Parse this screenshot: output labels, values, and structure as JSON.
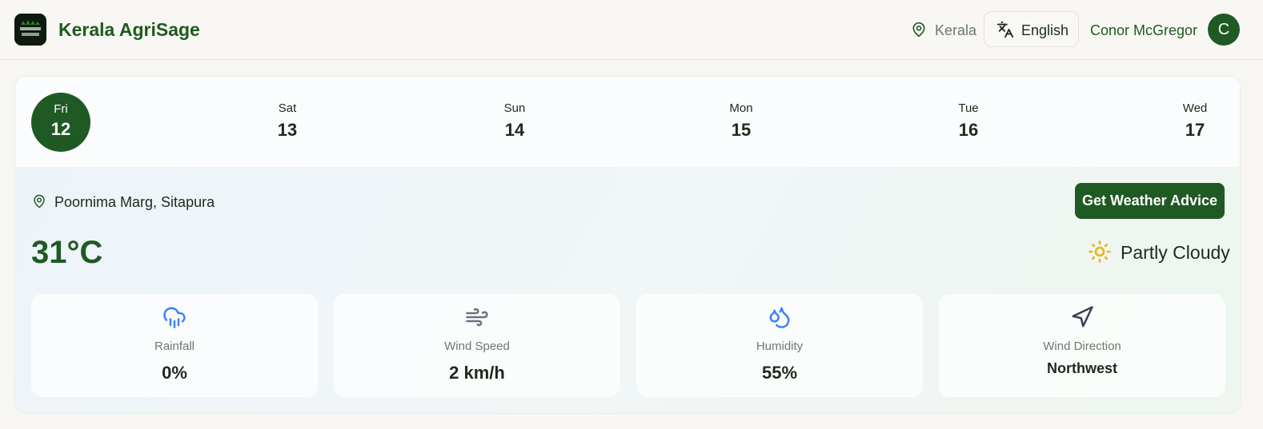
{
  "header": {
    "logo_text": "KERALA AgriSage",
    "brand": "Kerala AgriSage",
    "location": "Kerala",
    "language": "English",
    "user_name": "Conor McGregor",
    "avatar_initial": "C"
  },
  "days": [
    {
      "name": "Fri",
      "date": "12",
      "active": true
    },
    {
      "name": "Sat",
      "date": "13"
    },
    {
      "name": "Sun",
      "date": "14"
    },
    {
      "name": "Mon",
      "date": "15"
    },
    {
      "name": "Tue",
      "date": "16"
    },
    {
      "name": "Wed",
      "date": "17"
    }
  ],
  "weather": {
    "address": "Poornima Marg, Sitapura",
    "advice_button": "Get Weather Advice",
    "temperature": "31°C",
    "condition": "Partly Cloudy",
    "condition_icon": "sun-icon",
    "stats": [
      {
        "label": "Rainfall",
        "value": "0%",
        "icon": "rain-cloud-icon"
      },
      {
        "label": "Wind Speed",
        "value": "2 km/h",
        "icon": "wind-icon"
      },
      {
        "label": "Humidity",
        "value": "55%",
        "icon": "droplets-icon"
      },
      {
        "label": "Wind Direction",
        "value": "Northwest",
        "icon": "navigation-icon"
      }
    ]
  },
  "colors": {
    "brand_green": "#1f5a24",
    "rain_blue": "#3b82f6",
    "sun_yellow": "#eab308"
  }
}
